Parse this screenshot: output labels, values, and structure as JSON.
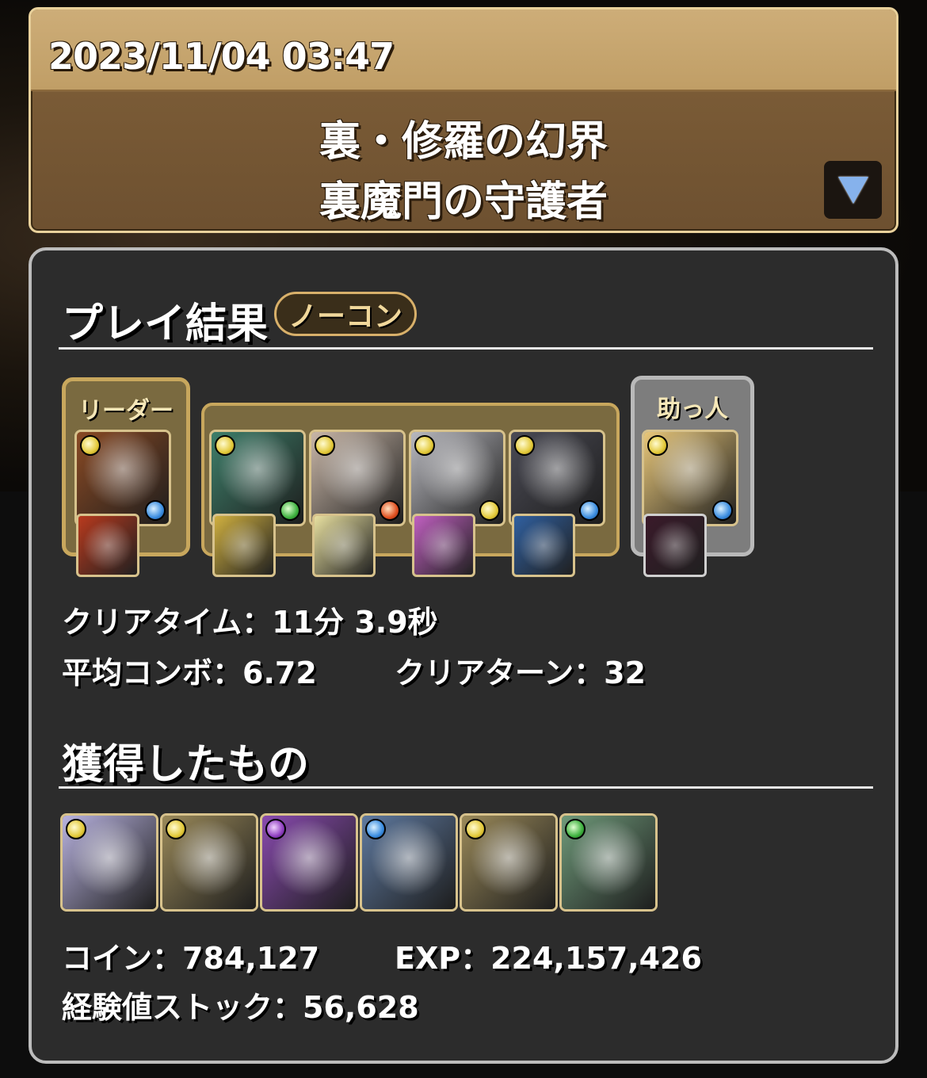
{
  "header": {
    "timestamp": "2023/11/04 03:47",
    "dungeon_name": "裏・修羅の幻界",
    "floor_name": "裏魔門の守護者"
  },
  "result": {
    "section_title": "プレイ結果",
    "badge": "ノーコン",
    "leader_label": "リーダー",
    "helper_label": "助っ人",
    "team": [
      {
        "slot": "leader",
        "attr_main": "light",
        "attr_sub": "water",
        "art_color": "#8a4a24"
      },
      {
        "slot": "sub1",
        "attr_main": "light",
        "attr_sub": "wood",
        "art_color": "#3e7f6a"
      },
      {
        "slot": "sub2",
        "attr_main": "light",
        "attr_sub": "fire",
        "art_color": "#c9b7a8"
      },
      {
        "slot": "sub3",
        "attr_main": "light",
        "attr_sub": "light",
        "art_color": "#b9b9bf"
      },
      {
        "slot": "sub4",
        "attr_main": "light",
        "attr_sub": "water",
        "art_color": "#4b4b55"
      },
      {
        "slot": "helper",
        "attr_main": "light",
        "attr_sub": "water",
        "art_color": "#e8c77a"
      }
    ],
    "clear_time": "クリアタイム：11分 3.9秒",
    "avg_combo": "平均コンボ：6.72",
    "clear_turns": "クリアターン：32"
  },
  "rewards": {
    "section_title": "獲得したもの",
    "drops": [
      {
        "attr": "light",
        "art_color": "#b9b3e0"
      },
      {
        "attr": "light",
        "art_color": "#9b8a5a"
      },
      {
        "attr": "dark",
        "art_color": "#8a4bb0"
      },
      {
        "attr": "water",
        "art_color": "#5f7aa0"
      },
      {
        "attr": "light",
        "art_color": "#9b8a5a"
      },
      {
        "attr": "wood",
        "art_color": "#6f9a7a"
      }
    ],
    "coin": "コイン：784,127",
    "exp": "EXP：224,157,426",
    "exp_stock": "経験値ストック：56,628"
  }
}
